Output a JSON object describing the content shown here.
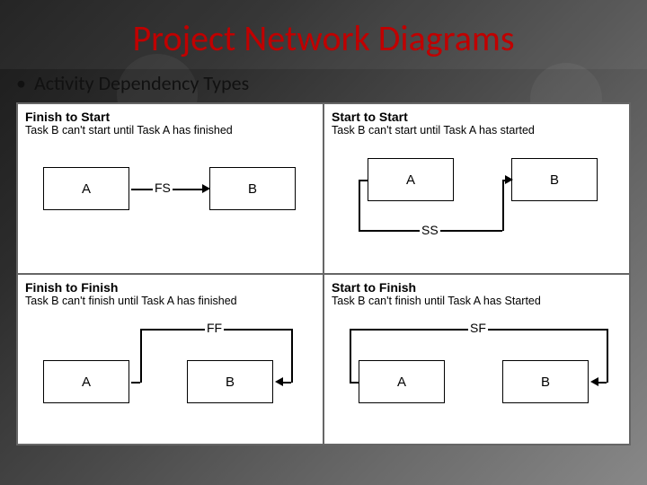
{
  "title": "Project Network Diagrams",
  "bullet": "Activity Dependency Types",
  "cells": {
    "fs": {
      "title": "Finish to Start",
      "sub": "Task B can't start until Task A has finished",
      "label": "FS",
      "a": "A",
      "b": "B"
    },
    "ss": {
      "title": "Start to Start",
      "sub": "Task B can't start until Task A has started",
      "label": "SS",
      "a": "A",
      "b": "B"
    },
    "ff": {
      "title": "Finish to Finish",
      "sub": "Task B can't finish until Task A has finished",
      "label": "FF",
      "a": "A",
      "b": "B"
    },
    "sf": {
      "title": "Start to Finish",
      "sub": "Task B can't finish until Task A has Started",
      "label": "SF",
      "a": "A",
      "b": "B"
    }
  }
}
